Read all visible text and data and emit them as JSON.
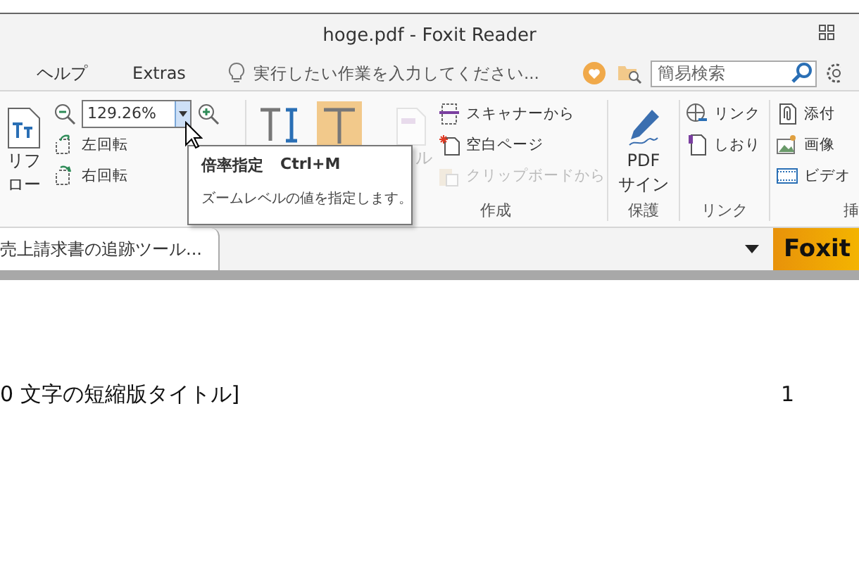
{
  "window": {
    "title": "hoge.pdf - Foxit Reader"
  },
  "menu": [
    {
      "label": "ヘルプ"
    },
    {
      "label": "Extras"
    }
  ],
  "tell_me": {
    "placeholder": "実行したい作業を入力してください..."
  },
  "search": {
    "placeholder": "簡易検索"
  },
  "view_group": {
    "reflow_lines": [
      "リフ",
      "ロー"
    ],
    "zoom_value": "129.26%",
    "dropdown_hovered": true,
    "rotate": [
      {
        "kind": "left",
        "label": "左回転"
      },
      {
        "kind": "right",
        "label": "右回転"
      }
    ]
  },
  "text_tools": [
    {
      "kind": "select",
      "selected": false
    },
    {
      "kind": "type",
      "selected": true
    }
  ],
  "create_group": {
    "label": "作成",
    "from_file_lines": [
      "ル"
    ],
    "from_file_disabled": true,
    "items": [
      {
        "kind": "scanner",
        "label": "スキャナーから",
        "disabled": false
      },
      {
        "kind": "blank",
        "label": "空白ページ",
        "disabled": false
      },
      {
        "kind": "clipboard",
        "label": "クリップボードから",
        "disabled": true
      }
    ]
  },
  "protect_group": {
    "label": "保護",
    "button_lines": [
      "PDF",
      "サイン"
    ]
  },
  "link_group": {
    "label": "リンク",
    "items": [
      {
        "kind": "link",
        "label": "リンク"
      },
      {
        "kind": "bookmark",
        "label": "しおり"
      }
    ]
  },
  "insert_group": {
    "label": "挿",
    "items": [
      {
        "kind": "attach",
        "label": "添付"
      },
      {
        "kind": "image",
        "label": "画像"
      },
      {
        "kind": "video",
        "label": "ビデオ"
      }
    ]
  },
  "tooltip": {
    "title": "倍率指定",
    "shortcut": "Ctrl+M",
    "description": "ズームレベルの値を指定します。"
  },
  "tabs": [
    {
      "label": "売上請求書の追跡ツール...",
      "selected": true
    }
  ],
  "brand": "Foxit",
  "document": {
    "line": "0 文字の短縮版タイトル]",
    "page": "1"
  }
}
